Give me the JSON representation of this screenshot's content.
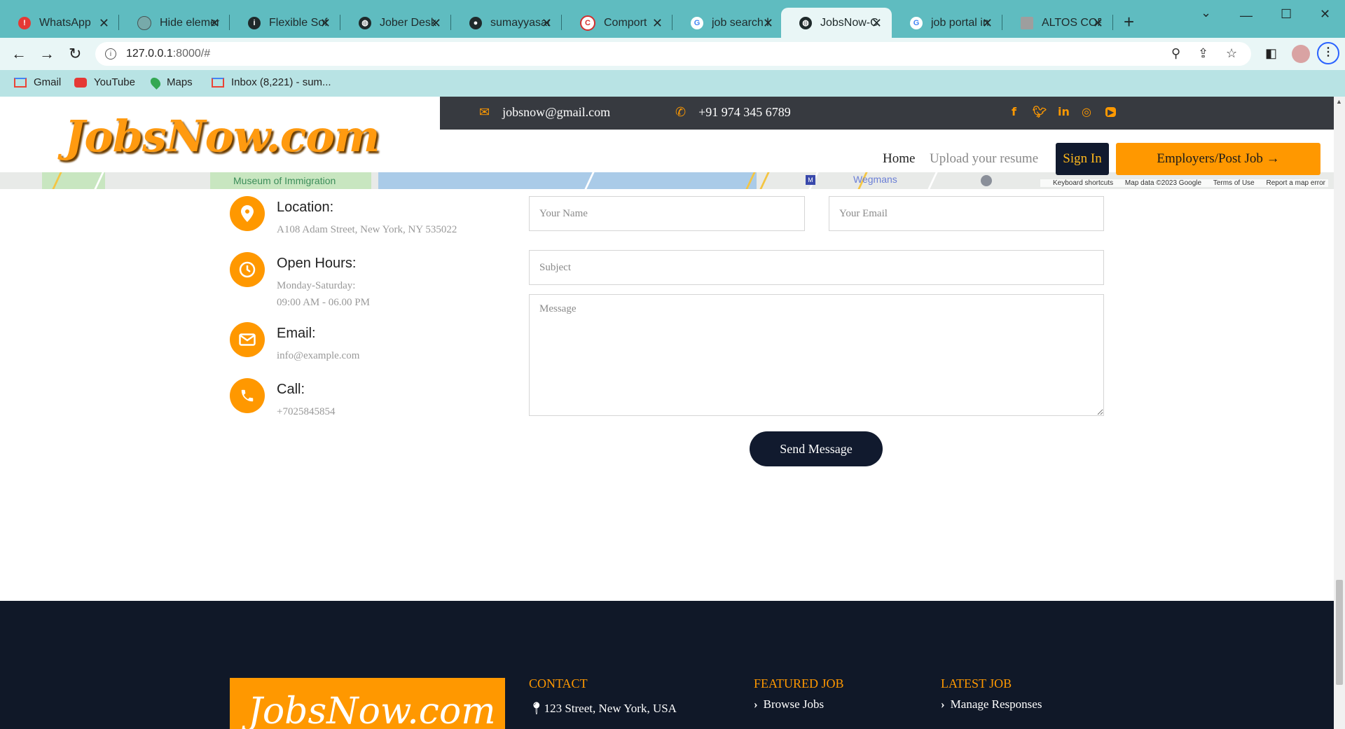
{
  "browser": {
    "tabs": [
      {
        "label": "WhatsApp",
        "icon": "whatsapp-icon",
        "color": "#e53935"
      },
      {
        "label": "Hide element",
        "icon": "openai-icon",
        "color": "#5a8f8f"
      },
      {
        "label": "Flexible Sof",
        "icon": "info-icon",
        "color": "#1f2a2b"
      },
      {
        "label": "Jober Desk",
        "icon": "globe-icon",
        "color": "#1f2a2b"
      },
      {
        "label": "sumayyasar",
        "icon": "github-icon",
        "color": "#1f2a2b"
      },
      {
        "label": "Comport",
        "icon": "comport-icon",
        "color": "#d32f2f"
      },
      {
        "label": "job search l",
        "icon": "google-icon",
        "color": "#4285f4"
      },
      {
        "label": "JobsNow-C",
        "icon": "globe-icon",
        "color": "#1f2a2b"
      },
      {
        "label": "job portal in",
        "icon": "google-icon",
        "color": "#4285f4"
      },
      {
        "label": "ALTOS COR",
        "icon": "altos-icon",
        "color": "#9e9e9e"
      }
    ],
    "url_host": "127.0.0.1",
    "url_rest": ":8000/#",
    "bookmarks": [
      {
        "label": "Gmail",
        "icon": "gmail-icon"
      },
      {
        "label": "YouTube",
        "icon": "youtube-icon"
      },
      {
        "label": "Maps",
        "icon": "maps-icon"
      },
      {
        "label": "Inbox (8,221) - sum...",
        "icon": "gmail-icon"
      }
    ]
  },
  "topbar": {
    "email": "jobsnow@gmail.com",
    "phone": "+91 974 345 6789"
  },
  "header": {
    "logo": "JobsNow.com",
    "nav_home": "Home",
    "nav_upload": "Upload your resume",
    "signin": "Sign In",
    "post_job": "Employers/Post Job →"
  },
  "map": {
    "museum_label": "Museum of Immigration",
    "wegmans_label": "Wegmans",
    "keyboard": "Keyboard shortcuts",
    "mapdata": "Map data ©2023 Google",
    "terms": "Terms of Use",
    "report": "Report a map error"
  },
  "contact_info": {
    "location_title": "Location:",
    "location_text": "A108 Adam Street, New York, NY 535022",
    "hours_title": "Open Hours:",
    "hours_line1": "Monday-Saturday:",
    "hours_line2": "09:00 AM - 06.00 PM",
    "email_title": "Email:",
    "email_text": "info@example.com",
    "call_title": "Call:",
    "call_text": "+7025845854"
  },
  "form": {
    "name_placeholder": "Your Name",
    "email_placeholder": "Your Email",
    "subject_placeholder": "Subject",
    "message_placeholder": "Message",
    "send_label": "Send Message"
  },
  "footer": {
    "logo": "JobsNow.com",
    "contact_heading": "CONTACT",
    "contact_address": "123 Street, New York, USA",
    "featured_heading": "FEATURED JOB",
    "featured_link": "Browse Jobs",
    "latest_heading": "LATEST JOB",
    "latest_link": "Manage Responses"
  },
  "colors": {
    "accent": "#ff9800",
    "dark_navy": "#111a2e",
    "topbar": "#373a40",
    "chrome_tabbar": "#5fbcc0"
  }
}
